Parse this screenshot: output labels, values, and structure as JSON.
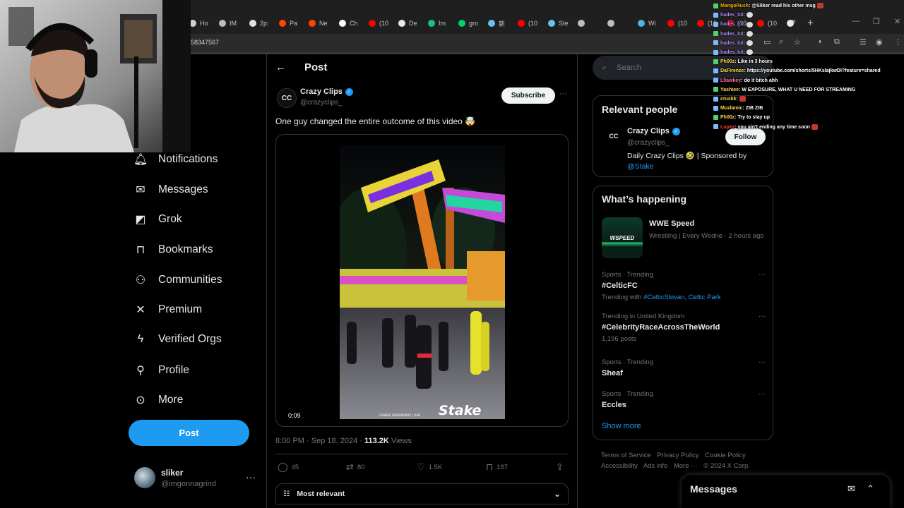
{
  "browser": {
    "tabs": [
      {
        "label": "Ho",
        "color": "#d0d0d0"
      },
      {
        "label": "IM",
        "color": "#bdbdbd"
      },
      {
        "label": "2p:",
        "color": "#e0e0e0"
      },
      {
        "label": "Pa",
        "color": "#ff4500"
      },
      {
        "label": "Ne",
        "color": "#ff4500"
      },
      {
        "label": "Ch",
        "color": "#ffffff"
      },
      {
        "label": "(10",
        "color": "#ff0000"
      },
      {
        "label": "De",
        "color": "#e7e9ea"
      },
      {
        "label": "Im",
        "color": "#19c37d"
      },
      {
        "label": "gro",
        "color": "#00d26a"
      },
      {
        "label": "新",
        "color": "#66c0f4"
      },
      {
        "label": "(10",
        "color": "#ff0000"
      },
      {
        "label": "Ste",
        "color": "#66c0f4"
      },
      {
        "label": "",
        "color": "#bdbdbd"
      },
      {
        "label": "",
        "color": "#bdbdbd"
      },
      {
        "label": "Wi",
        "color": "#4fb3e8"
      },
      {
        "label": "(10",
        "color": "#ff0000"
      },
      {
        "label": "(10",
        "color": "#ff0000"
      },
      {
        "label": "(10",
        "color": "#ff0000"
      },
      {
        "label": "(10",
        "color": "#ff0000"
      },
      {
        "label": "",
        "color": "#e7e9ea"
      }
    ],
    "url_fragment": "58347567"
  },
  "nav": {
    "partial_label": "e",
    "items": [
      {
        "label": "Notifications",
        "icon": "bell-icon"
      },
      {
        "label": "Messages",
        "icon": "envelope-icon"
      },
      {
        "label": "Grok",
        "icon": "grok-icon"
      },
      {
        "label": "Bookmarks",
        "icon": "bookmark-icon"
      },
      {
        "label": "Communities",
        "icon": "people-icon"
      },
      {
        "label": "Premium",
        "icon": "x-logo-icon"
      },
      {
        "label": "Verified Orgs",
        "icon": "lightning-icon"
      },
      {
        "label": "Profile",
        "icon": "person-icon"
      },
      {
        "label": "More",
        "icon": "more-circle-icon"
      }
    ],
    "post_button": "Post",
    "account": {
      "name": "sliker",
      "handle": "@imgonnagrind",
      "more": "···"
    }
  },
  "post": {
    "header": "Post",
    "author": {
      "avatar_text": "CC",
      "name": "Crazy Clips",
      "handle": "@crazyclips_"
    },
    "subscribe": "Subscribe",
    "more": "···",
    "text": "One guy changed the entire outcome of this video 🤯",
    "video": {
      "time": "0:09",
      "watermark": "Stake",
      "caption": "GAMBLE RESPONSIBLY  |  #AD"
    },
    "meta": {
      "time": "8:00 PM · Sep 18, 2024 · ",
      "views": "113.2K",
      "views_label": " Views"
    },
    "actions": {
      "replies": "45",
      "reposts": "80",
      "likes": "1.5K",
      "bookmarks": "187"
    },
    "sort_label": "Most relevant"
  },
  "sidebar": {
    "search_placeholder": "Search",
    "relevant": {
      "title": "Relevant people",
      "avatar_text": "CC",
      "name": "Crazy Clips",
      "handle": "@crazyclips_",
      "bio": "Daily Crazy Clips 🤣 | Sponsored by",
      "bio_link": "@Stake",
      "follow": "Follow"
    },
    "happening": {
      "title": "What’s happening",
      "featured": {
        "thumb_text": "WSPEED",
        "title": "WWE Speed",
        "meta": "Wrestling | Every Wedne · 2 hours ago"
      },
      "trends": [
        {
          "category": "Sports · Trending",
          "name": "#CelticFC",
          "sub_prefix": "Trending with ",
          "sub_link": "#CelticSlovan, Celtic Park"
        },
        {
          "category": "Trending in United Kingdom",
          "name": "#CelebrityRaceAcrossTheWorld",
          "sub_prefix": "1,196 posts",
          "sub_link": ""
        },
        {
          "category": "Sports · Trending",
          "name": "Sheaf",
          "sub_prefix": "",
          "sub_link": ""
        },
        {
          "category": "Sports · Trending",
          "name": "Eccles",
          "sub_prefix": "",
          "sub_link": ""
        }
      ],
      "show_more": "Show more"
    },
    "footer": [
      "Terms of Service",
      "Privacy Policy",
      "Cookie Policy",
      "Accessibility",
      "Ads info",
      "More ···",
      "© 2024 X Corp."
    ]
  },
  "messages_drawer": {
    "title": "Messages"
  },
  "chat": [
    {
      "user": "MangoRush",
      "color": "#ffb000",
      "text": ": @Sliker read his other msg"
    },
    {
      "user": "hades_lol",
      "color": "#b28dff",
      "text": ":"
    },
    {
      "user": "hades_lol",
      "color": "#b28dff",
      "text": ":"
    },
    {
      "user": "hades_lol",
      "color": "#b28dff",
      "text": ":"
    },
    {
      "user": "hades_lol",
      "color": "#b28dff",
      "text": ":"
    },
    {
      "user": "hades_lol",
      "color": "#b28dff",
      "text": ":"
    },
    {
      "user": "Ph00z",
      "color": "#ffd84d",
      "text": ": Like in 3 hours"
    },
    {
      "user": "DaFirenze",
      "color": "#ffd84d",
      "text": ": https://youtube.com/shorts/5HKslajkwDI?feature=shared"
    },
    {
      "user": "L0awkey",
      "color": "#ff6b9d",
      "text": ": do it bitch ahh"
    },
    {
      "user": "Yashiee",
      "color": "#ffd84d",
      "text": ": W EXPOSURE, WHAT U NEED FOR STREAMING"
    },
    {
      "user": "cruskk",
      "color": "#ffd84d",
      "text": ":"
    },
    {
      "user": "Muzlamic",
      "color": "#ffd84d",
      "text": ": ZIB ZIB"
    },
    {
      "user": "Ph00z",
      "color": "#ffd84d",
      "text": ": Try to stay up"
    },
    {
      "user": "Lopez",
      "color": "#ff3b3b",
      "text": ": you ain't ending any time soon"
    }
  ]
}
